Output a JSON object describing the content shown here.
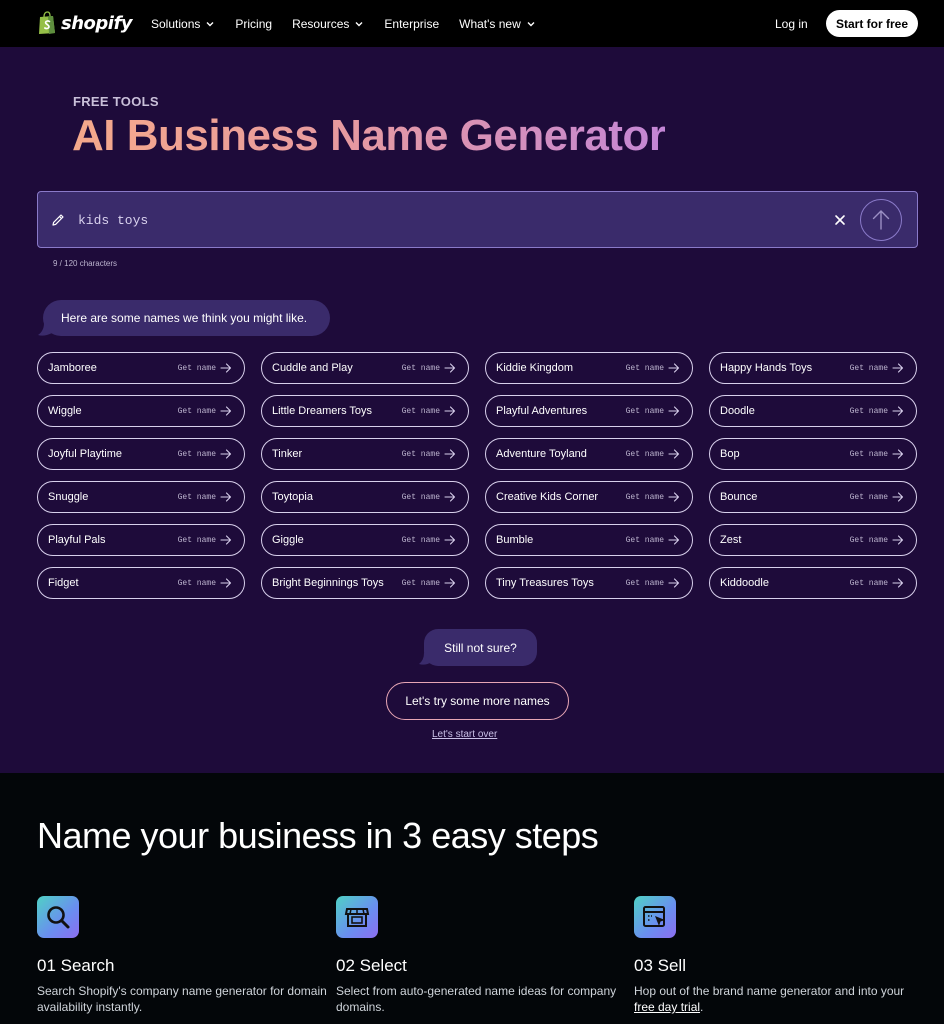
{
  "nav": {
    "logo_text": "shopify",
    "items": [
      {
        "label": "Solutions",
        "has_dropdown": true
      },
      {
        "label": "Pricing",
        "has_dropdown": false
      },
      {
        "label": "Resources",
        "has_dropdown": true
      },
      {
        "label": "Enterprise",
        "has_dropdown": false
      },
      {
        "label": "What's new",
        "has_dropdown": true
      }
    ],
    "login_label": "Log in",
    "cta_label": "Start for free"
  },
  "hero": {
    "eyebrow": "FREE TOOLS",
    "title": "AI Business Name Generator",
    "search_value": "kids toys",
    "char_count": "9 / 120 characters",
    "bubble_text": "Here are some names we think you might like.",
    "get_name_label": "Get name",
    "names": [
      "Jamboree",
      "Cuddle and Play",
      "Kiddie Kingdom",
      "Happy Hands Toys",
      "Wiggle",
      "Little Dreamers Toys",
      "Playful Adventures",
      "Doodle",
      "Joyful Playtime",
      "Tinker",
      "Adventure Toyland",
      "Bop",
      "Snuggle",
      "Toytopia",
      "Creative Kids Corner",
      "Bounce",
      "Playful Pals",
      "Giggle",
      "Bumble",
      "Zest",
      "Fidget",
      "Bright Beginnings Toys",
      "Tiny Treasures Toys",
      "Kiddoodle"
    ],
    "still_not_sure": "Still not sure?",
    "more_names_label": "Let's try some more names",
    "start_over_label": "Let's start over"
  },
  "steps": {
    "title": "Name your business in 3 easy steps",
    "items": [
      {
        "title": "01 Search",
        "desc": "Search Shopify's company name generator for domain availability instantly.",
        "icon": "search-icon"
      },
      {
        "title": "02 Select",
        "desc": "Select from auto-generated name ideas for company domains.",
        "icon": "storefront-icon"
      },
      {
        "title": "03 Sell",
        "desc_prefix": "Hop out of the brand name generator and into your ",
        "link": "free day trial",
        "desc_suffix": ".",
        "icon": "browser-cursor-icon"
      }
    ]
  },
  "colors": {
    "hero_bg": "#1e0b3a",
    "bubble_bg": "#3a2b6b",
    "steps_bg": "#030609",
    "title_gradient_start": "#f5a98b",
    "title_gradient_end": "#c486d6"
  }
}
